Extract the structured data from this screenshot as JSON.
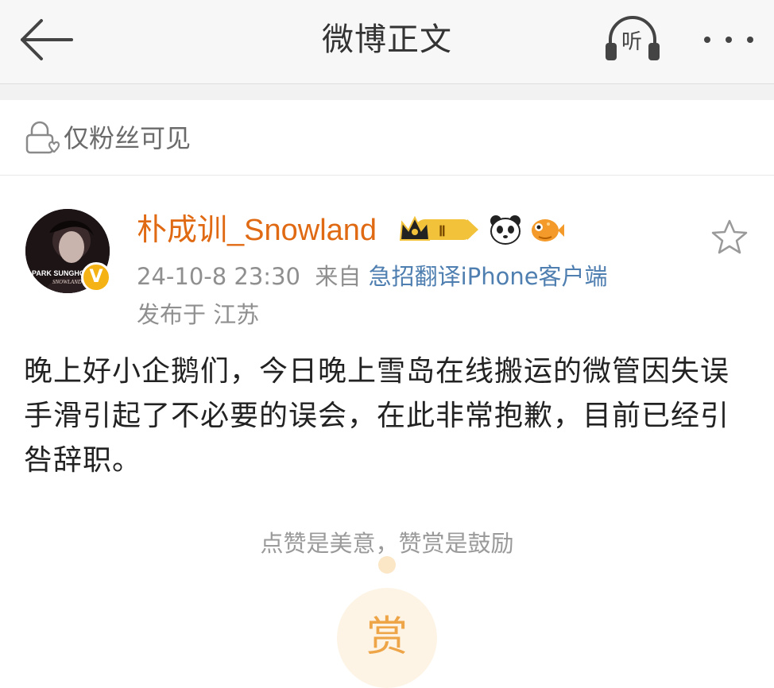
{
  "navbar": {
    "title": "微博正文",
    "back_icon": "arrow-left-icon",
    "listen_label": "听",
    "listen_icon": "headphones-icon",
    "more_icon": "more-dots-icon"
  },
  "visibility": {
    "label": "仅粉丝可见",
    "icon": "lock-heart-icon"
  },
  "post": {
    "author": {
      "name": "朴成训_Snowland",
      "avatar_text_1": "PARK SUNGHOON",
      "avatar_text_2": "SNOWLAND",
      "verify_label": "V",
      "vip_level": "Ⅱ"
    },
    "timestamp": "24-10-8 23:30",
    "source_prefix": "来自",
    "source": "急招翻译iPhone客户端",
    "location": "发布于 江苏",
    "text": "晚上好小企鹅们，今日晚上雪岛在线搬运的微管因失误手滑引起了不必要的误会，在此非常抱歉，目前已经引咎辞职。"
  },
  "reward": {
    "hint": "点赞是美意，赞赏是鼓励",
    "button_label": "赏"
  },
  "colors": {
    "username": "#e06a13",
    "source_link": "#4f7fb0",
    "reward_accent": "#eea548"
  }
}
